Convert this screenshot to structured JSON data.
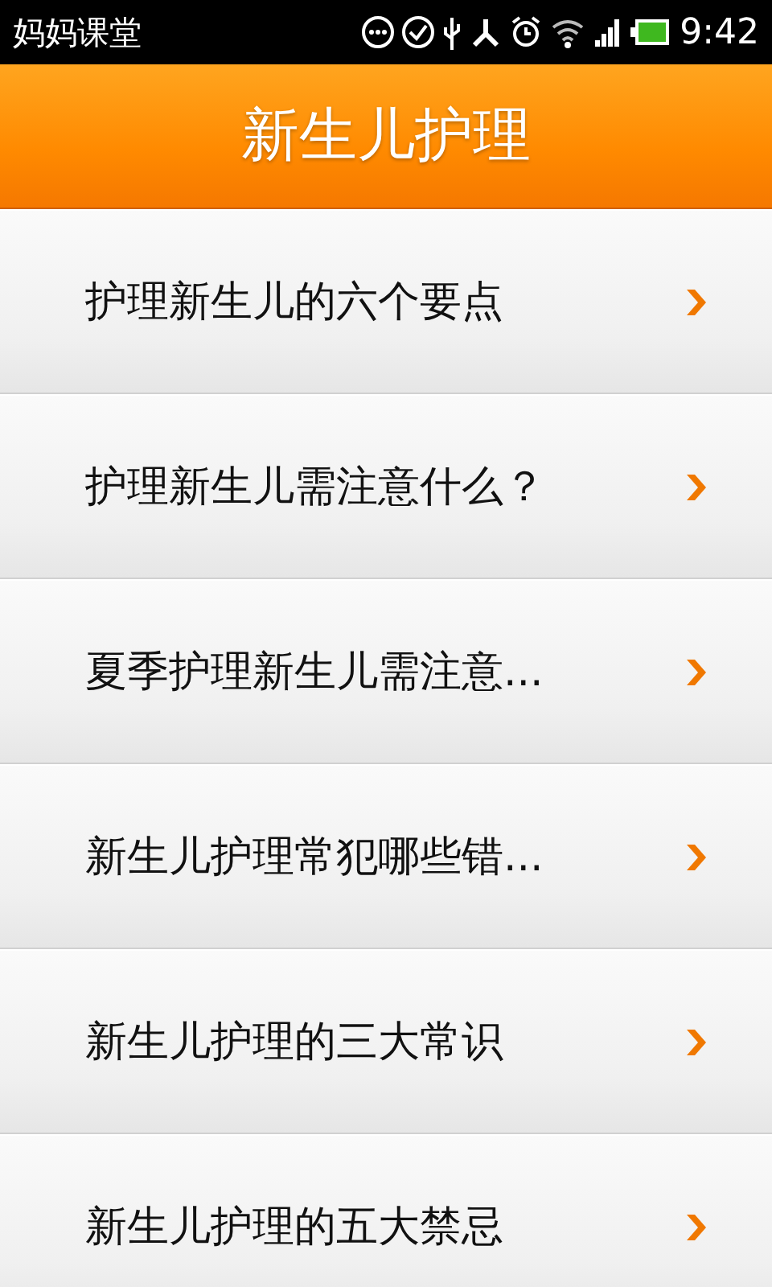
{
  "status_bar": {
    "app_name": "妈妈课堂",
    "time": "9:42"
  },
  "header": {
    "title": "新生儿护理"
  },
  "items": [
    {
      "label": "护理新生儿的六个要点"
    },
    {
      "label": "护理新生儿需注意什么？"
    },
    {
      "label": "夏季护理新生儿需注意..."
    },
    {
      "label": "新生儿护理常犯哪些错..."
    },
    {
      "label": "新生儿护理的三大常识"
    },
    {
      "label": "新生儿护理的五大禁忌"
    }
  ]
}
